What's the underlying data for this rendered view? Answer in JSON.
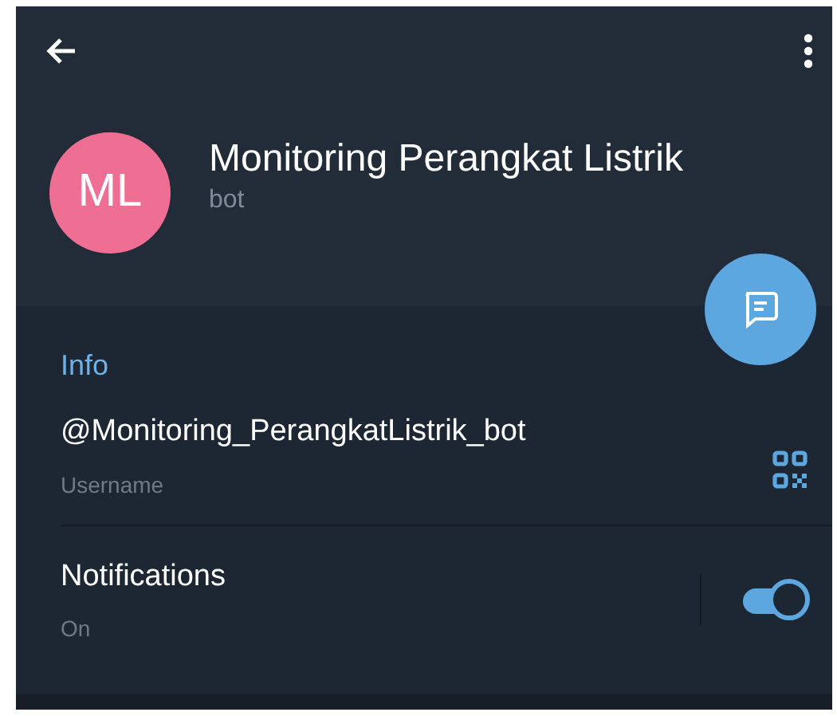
{
  "profile": {
    "initials": "ML",
    "name": "Monitoring Perangkat Listrik",
    "status": "bot"
  },
  "info": {
    "heading": "Info",
    "rows": [
      {
        "kind": "username",
        "value": "@Monitoring_PerangkatListrik_bot",
        "label": "Username"
      },
      {
        "kind": "toggle",
        "value": "Notifications",
        "label": "On",
        "on": true
      }
    ]
  }
}
